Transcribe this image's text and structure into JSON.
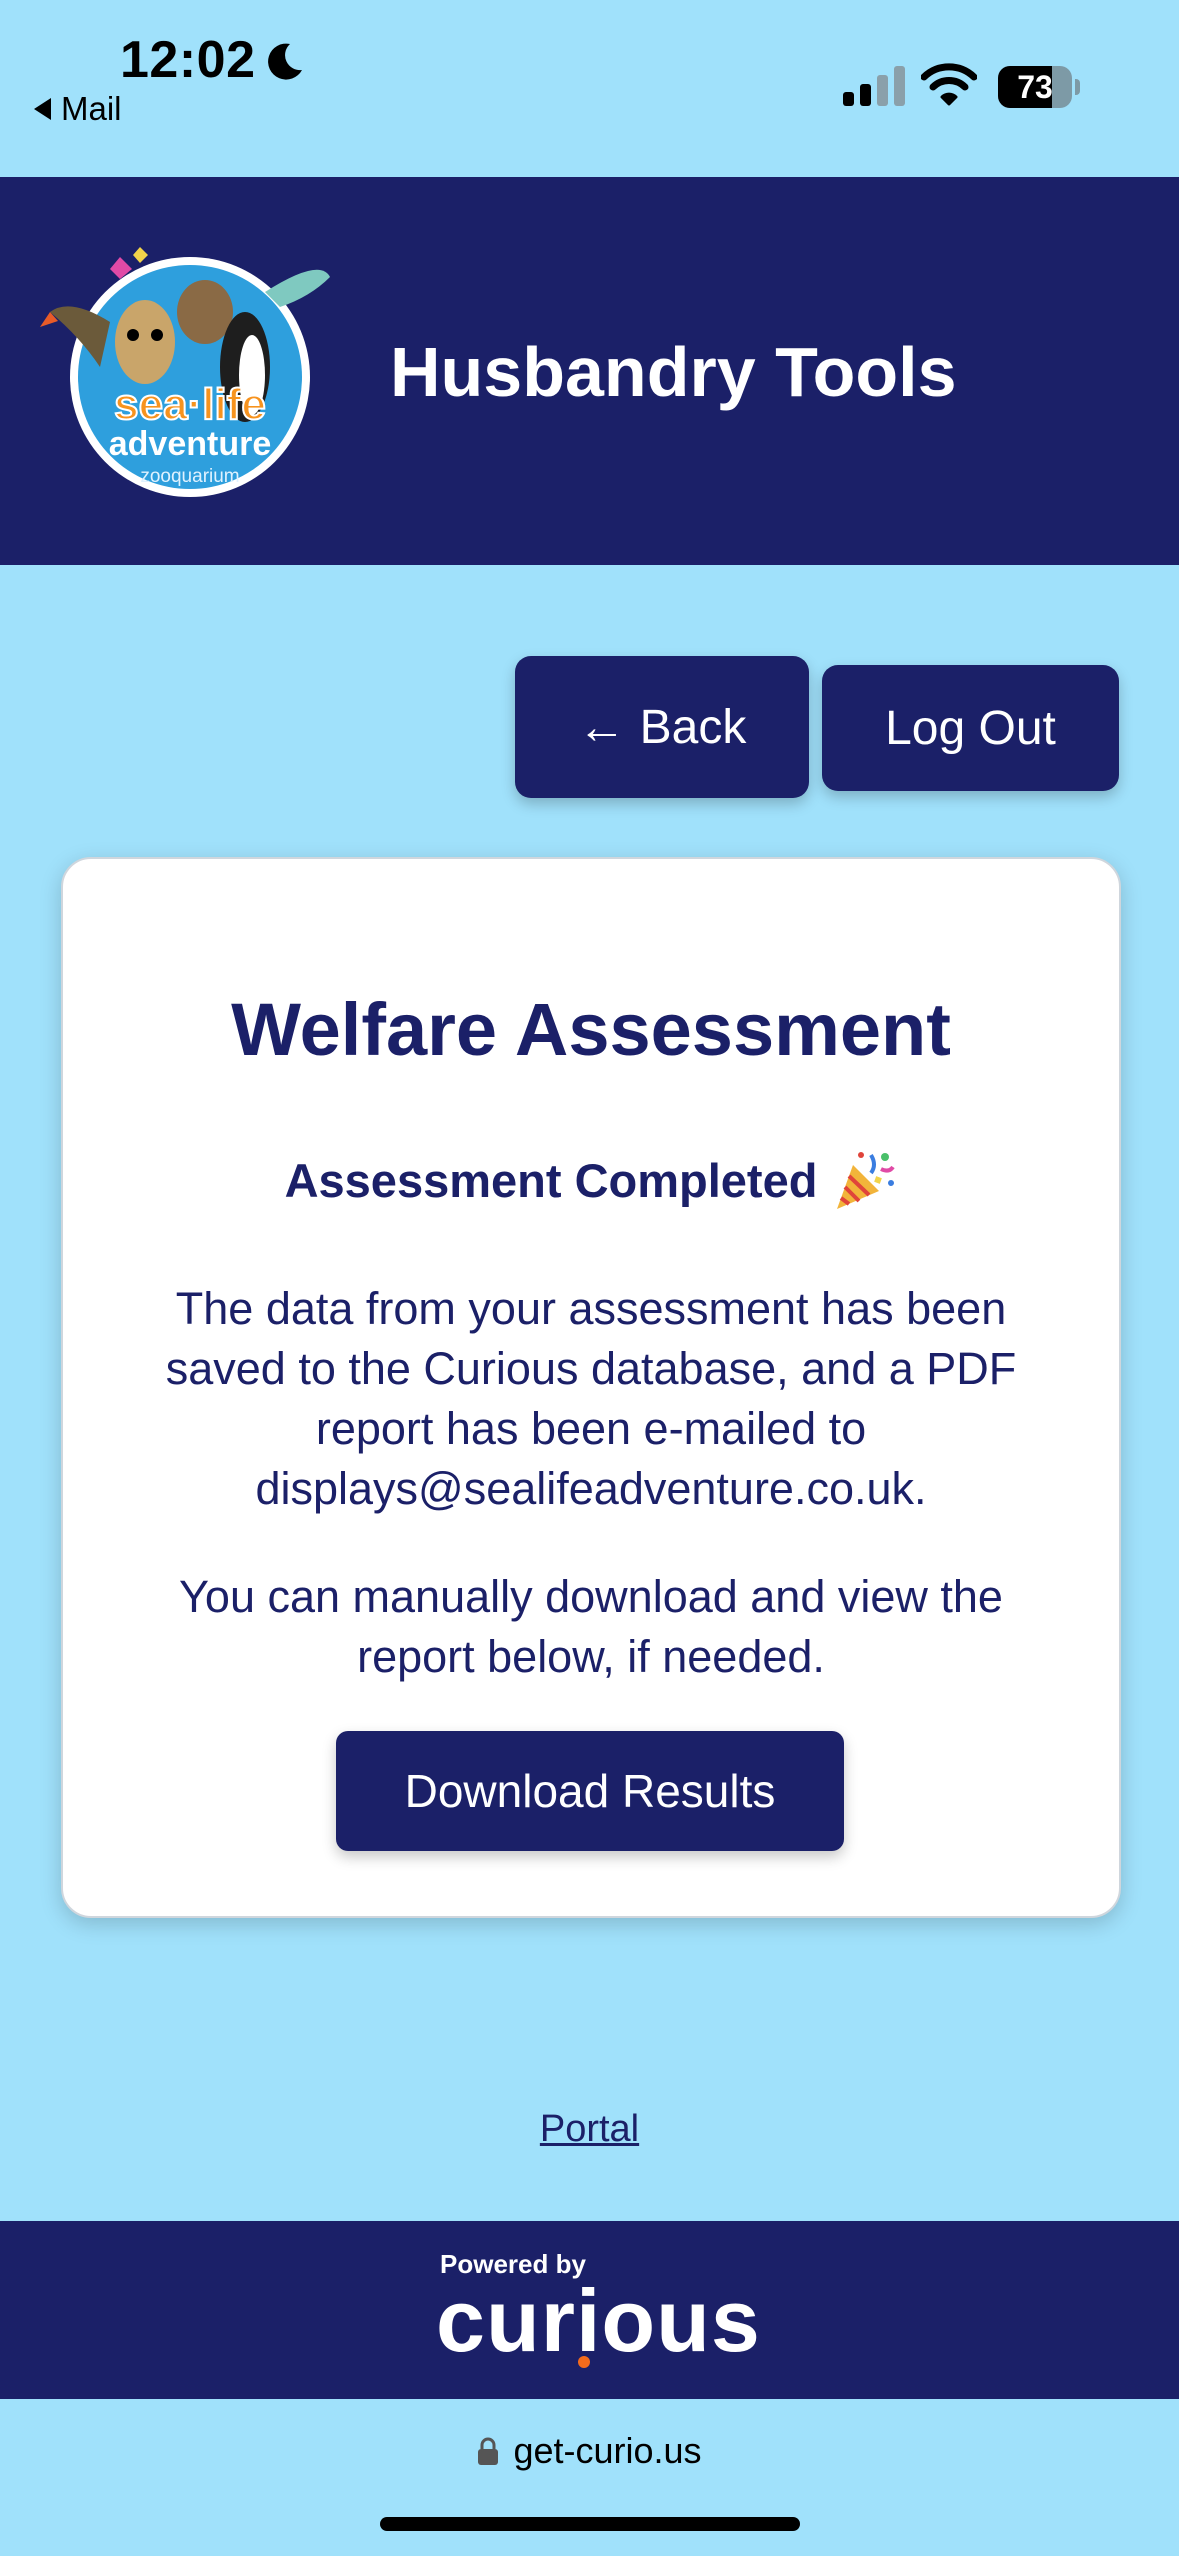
{
  "status_bar": {
    "time": "12:02",
    "back_app": "Mail",
    "battery": "73",
    "battery_level": 0.73
  },
  "header": {
    "title": "Husbandry Tools",
    "logo": {
      "line1": "sea·life",
      "line2": "adventure",
      "line3": "zooquarium"
    }
  },
  "nav": {
    "back_arrow": "←",
    "back_label": "Back",
    "logout_label": "Log Out"
  },
  "card": {
    "title": "Welfare Assessment",
    "subtitle": "Assessment Completed",
    "subtitle_emoji": "party-popper-icon",
    "saved_text": "The data from your assessment has been saved to the Curious database, and a PDF report has been e-mailed to displays@sealifeadventure.co.uk.",
    "manual_text": "You can manually download and view the report below, if needed.",
    "download_label": "Download Results"
  },
  "portal_link": "Portal",
  "footer": {
    "powered_by": "Powered by",
    "brand": "curious",
    "brand_accent": "#f36b1c"
  },
  "browser": {
    "url": "get-curio.us"
  },
  "colors": {
    "background": "#a0e1fb",
    "navy": "#1b2068"
  }
}
